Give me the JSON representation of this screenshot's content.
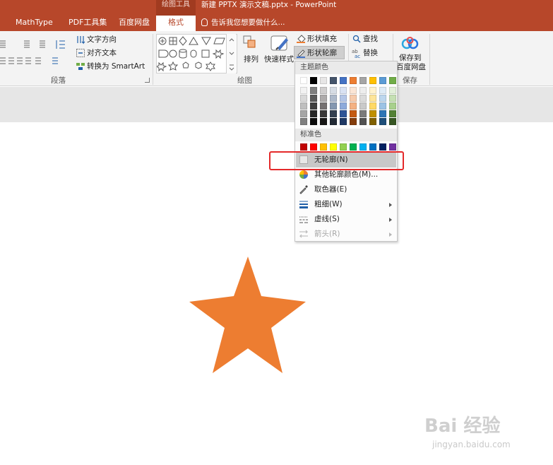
{
  "titlebar": {
    "contextual_group": "绘图工具",
    "document_title": "新建 PPTX 演示文稿.pptx - PowerPoint",
    "tell_me": "告诉我您想要做什么..."
  },
  "tabs": [
    {
      "label": "MathType"
    },
    {
      "label": "PDF工具集"
    },
    {
      "label": "百度网盘"
    },
    {
      "label": "格式"
    }
  ],
  "ribbon": {
    "paragraph": {
      "text_direction": "文字方向",
      "align_text": "对齐文本",
      "convert_smartart": "转换为 SmartArt",
      "group_label": "段落"
    },
    "drawing": {
      "arrange": "排列",
      "quick_styles": "快速样式",
      "shape_fill": "形状填充",
      "shape_outline": "形状轮廓",
      "group_label": "绘图"
    },
    "editing": {
      "find": "查找",
      "replace": "替换"
    },
    "save": {
      "save_to_line1": "保存到",
      "save_to_line2": "百度网盘",
      "group_label": "保存"
    }
  },
  "menu": {
    "theme_colors_label": "主题颜色",
    "standard_colors_label": "标准色",
    "theme_colors": [
      [
        "#ffffff",
        "#f2f2f2",
        "#d9d9d9",
        "#bfbfbf",
        "#a6a6a6",
        "#7f7f7f"
      ],
      [
        "#000000",
        "#7f7f7f",
        "#595959",
        "#3f3f3f",
        "#262626",
        "#0d0d0d"
      ],
      [
        "#e7e6e6",
        "#d0cece",
        "#aeabab",
        "#757171",
        "#3a3838",
        "#171616"
      ],
      [
        "#44546a",
        "#d6dce4",
        "#adb9ca",
        "#8497b0",
        "#333f4f",
        "#222a35"
      ],
      [
        "#4472c4",
        "#d9e2f3",
        "#b4c6e7",
        "#8eaadb",
        "#2f5496",
        "#1f3864"
      ],
      [
        "#ed7d31",
        "#fbe5d5",
        "#f7cbac",
        "#f4b183",
        "#c55a11",
        "#833c0b"
      ],
      [
        "#a5a5a5",
        "#ededed",
        "#dbdbdb",
        "#c9c9c9",
        "#7b7b7b",
        "#525252"
      ],
      [
        "#ffc000",
        "#fff2cc",
        "#fee599",
        "#ffd965",
        "#bf9000",
        "#7f6000"
      ],
      [
        "#5b9bd5",
        "#deebf6",
        "#bdd7ee",
        "#9cc3e5",
        "#2e75b5",
        "#1e4e79"
      ],
      [
        "#70ad47",
        "#e2efd9",
        "#c5e0b3",
        "#a8d08d",
        "#538135",
        "#375623"
      ]
    ],
    "standard_colors": [
      "#c00000",
      "#ff0000",
      "#ffc000",
      "#ffff00",
      "#92d050",
      "#00b050",
      "#00b0f0",
      "#0070c0",
      "#002060",
      "#7030a0"
    ],
    "items": [
      {
        "label": "无轮廓(N)",
        "icon": "no-outline-icon",
        "highlighted": true
      },
      {
        "label": "其他轮廓颜色(M)...",
        "icon": "color-wheel-icon"
      },
      {
        "label": "取色器(E)",
        "icon": "eyedropper-icon"
      },
      {
        "label": "粗细(W)",
        "icon": "line-weight-icon",
        "submenu": true
      },
      {
        "label": "虚线(S)",
        "icon": "dashes-icon",
        "submenu": true
      },
      {
        "label": "箭头(R)",
        "icon": "arrows-icon",
        "submenu": true,
        "disabled": true
      }
    ]
  },
  "canvas": {
    "shape": "star",
    "shape_fill_color": "#ed7d31"
  },
  "watermark": {
    "brand": "Bai 经验",
    "url": "jingyan.baidu.com"
  }
}
